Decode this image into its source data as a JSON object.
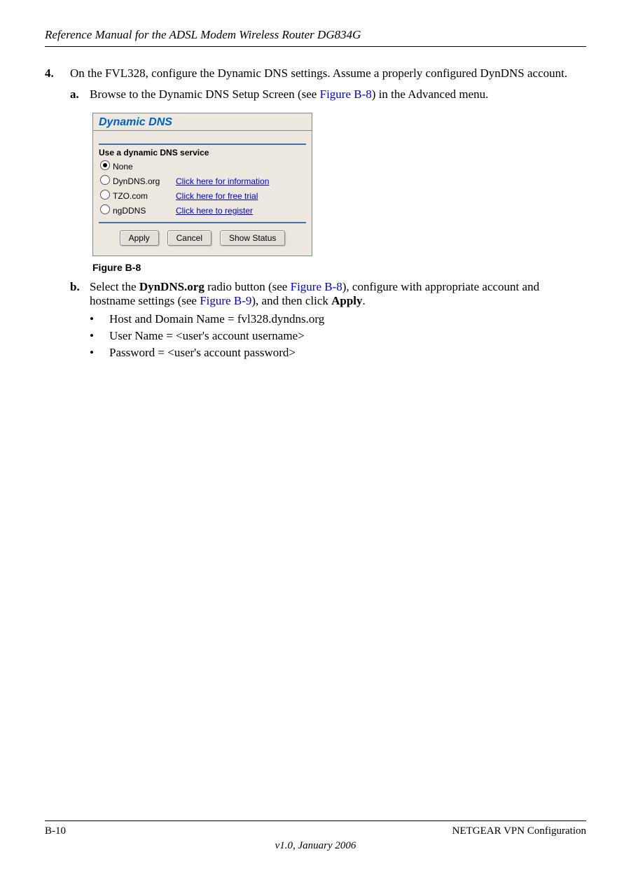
{
  "header": {
    "doc_title": "Reference Manual for the ADSL Modem Wireless Router DG834G"
  },
  "step4": {
    "num": "4.",
    "text_a": "On the FVL328, configure the Dynamic DNS settings. Assume a properly configured DynDNS account."
  },
  "step_a": {
    "lett": "a.",
    "pre": "Browse to the Dynamic DNS Setup Screen (see ",
    "link": "Figure B-8",
    "post": ") in the Advanced menu."
  },
  "ddns": {
    "title": "Dynamic DNS",
    "subtitle": "Use a dynamic DNS service",
    "opts": [
      {
        "label": "None",
        "link": "",
        "selected": true
      },
      {
        "label": "DynDNS.org",
        "link": "Click here for information",
        "selected": false
      },
      {
        "label": "TZO.com",
        "link": "Click here for free trial",
        "selected": false
      },
      {
        "label": "ngDDNS",
        "link": "Click here to register",
        "selected": false
      }
    ],
    "buttons": {
      "apply": "Apply",
      "cancel": "Cancel",
      "status": "Show Status"
    }
  },
  "fig_caption": "Figure B-8",
  "step_b": {
    "lett": "b.",
    "t1": "Select the ",
    "bold1": "DynDNS.org",
    "t2": " radio button (see ",
    "link1": "Figure B-8",
    "t3": "), configure with appropriate account and hostname settings (see ",
    "link2": "Figure B-9",
    "t4": "), and then click ",
    "bold2": "Apply",
    "t5": "."
  },
  "bullets": [
    "Host and Domain Name = fvl328.dyndns.org",
    "User Name = <user's account username>",
    "Password = <user's account password>"
  ],
  "footer": {
    "left": "B-10",
    "right": "NETGEAR VPN Configuration",
    "date": "v1.0, January 2006"
  }
}
